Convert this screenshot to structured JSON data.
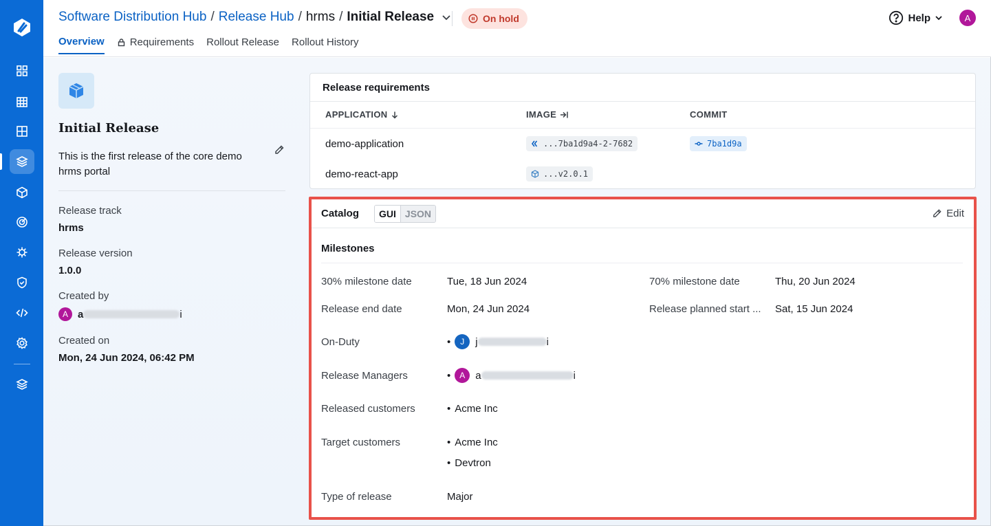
{
  "breadcrumb": {
    "items": [
      "Software Distribution Hub",
      "Release Hub"
    ],
    "plain": "hrms",
    "current": "Initial Release",
    "separator": "/"
  },
  "status": {
    "label": "On hold",
    "color": "#c0392b"
  },
  "tabs": [
    {
      "label": "Overview",
      "active": true
    },
    {
      "label": "Requirements",
      "icon": "lock-icon"
    },
    {
      "label": "Rollout Release"
    },
    {
      "label": "Rollout History"
    }
  ],
  "help": {
    "label": "Help"
  },
  "user": {
    "initial": "A",
    "color": "#b1179a"
  },
  "release": {
    "title": "Initial Release",
    "description": "This is the first release of the core demo hrms portal",
    "track_label": "Release track",
    "track": "hrms",
    "version_label": "Release version",
    "version": "1.0.0",
    "created_by_label": "Created by",
    "created_by_initial": "A",
    "created_by_first": "a",
    "created_by_last": "i",
    "created_on_label": "Created on",
    "created_on": "Mon, 24 Jun 2024, 06:42 PM"
  },
  "requirements": {
    "title": "Release requirements",
    "columns": [
      "APPLICATION",
      "IMAGE",
      "COMMIT"
    ],
    "rows": [
      {
        "application": "demo-application",
        "image": "...7ba1d9a4-2-7682",
        "image_icon": "devtron-icon",
        "commit": "7ba1d9a"
      },
      {
        "application": "demo-react-app",
        "image": "...v2.0.1",
        "image_icon": "package-icon",
        "commit": ""
      }
    ]
  },
  "catalog": {
    "title": "Catalog",
    "modes": [
      "GUI",
      "JSON"
    ],
    "active_mode": "GUI",
    "edit_label": "Edit",
    "section": "Milestones",
    "fields": {
      "m30_label": "30% milestone date",
      "m30": "Tue, 18 Jun 2024",
      "m70_label": "70% milestone date",
      "m70": "Thu, 20 Jun 2024",
      "end_label": "Release end date",
      "end": "Mon, 24 Jun 2024",
      "start_label": "Release planned start ...",
      "start": "Sat, 15 Jun 2024",
      "onduty_label": "On-Duty",
      "onduty_initial": "J",
      "onduty_first": "j",
      "onduty_last": "i",
      "managers_label": "Release Managers",
      "managers_initial": "A",
      "managers_first": "a",
      "managers_last": "i",
      "released_label": "Released customers",
      "released": [
        "Acme Inc"
      ],
      "target_label": "Target customers",
      "target": [
        "Acme Inc",
        "Devtron"
      ],
      "type_label": "Type of release",
      "type": "Major"
    }
  },
  "colors": {
    "brand": "#0b6bd6",
    "link": "#0b62c4",
    "highlight": "#e8524a",
    "avatar_j": "#1565c0",
    "avatar_a": "#b1179a"
  }
}
